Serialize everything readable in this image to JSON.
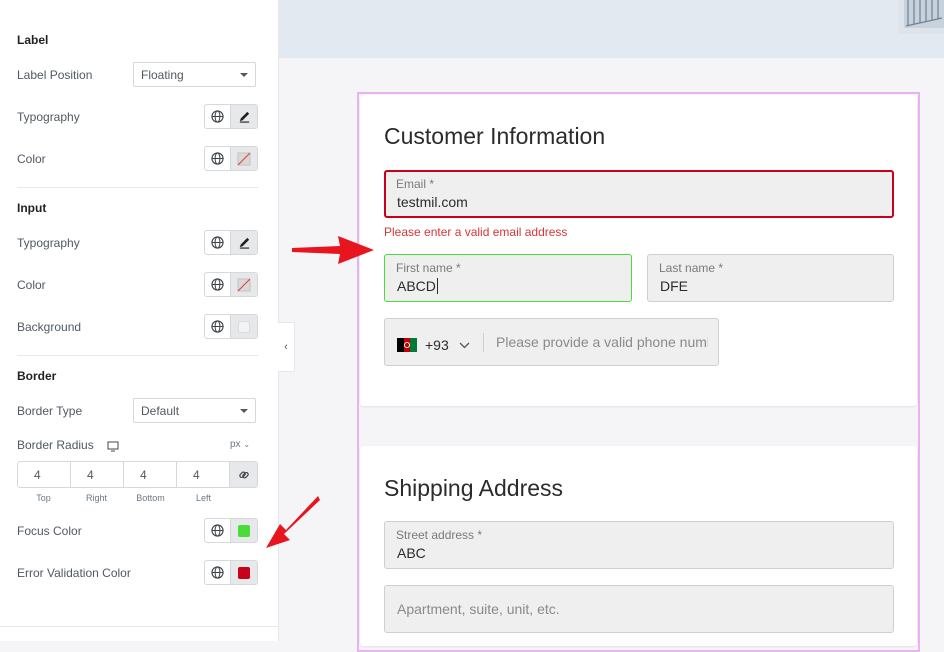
{
  "settings": {
    "label_section": {
      "title": "Label",
      "position_label": "Label Position",
      "position_value": "Floating",
      "typography_label": "Typography",
      "color_label": "Color"
    },
    "input_section": {
      "title": "Input",
      "typography_label": "Typography",
      "color_label": "Color",
      "background_label": "Background"
    },
    "border_section": {
      "title": "Border",
      "type_label": "Border Type",
      "type_value": "Default",
      "radius_label": "Border Radius",
      "radius_unit": "px",
      "radius_values": [
        "4",
        "4",
        "4",
        "4"
      ],
      "radius_sides": [
        "Top",
        "Right",
        "Bottom",
        "Left"
      ],
      "focus_label": "Focus Color",
      "focus_color": "#4cdc3a",
      "error_label": "Error Validation Color",
      "error_color": "#c9001b"
    }
  },
  "form": {
    "customer": {
      "title": "Customer Information",
      "email": {
        "label": "Email *",
        "value": "testmil.com",
        "error": "Please enter a valid email address"
      },
      "first_name": {
        "label": "First name *",
        "value": "ABCD"
      },
      "last_name": {
        "label": "Last name *",
        "value": "DFE"
      },
      "phone": {
        "code": "+93",
        "placeholder": "Please provide a valid phone numl"
      }
    },
    "shipping": {
      "title": "Shipping Address",
      "street": {
        "label": "Street address *",
        "value": "ABC"
      },
      "apartment": {
        "placeholder": "Apartment, suite, unit, etc."
      }
    }
  }
}
